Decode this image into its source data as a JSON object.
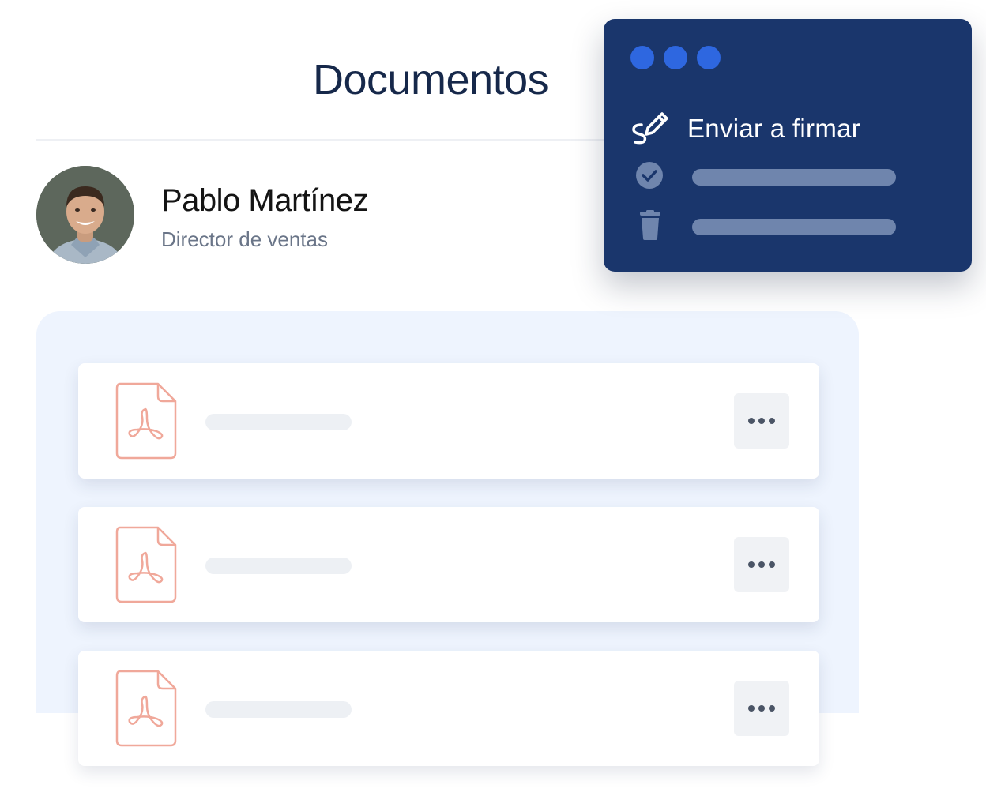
{
  "header": {
    "title": "Documentos"
  },
  "user": {
    "name": "Pablo Martínez",
    "role": "Director de ventas"
  },
  "documents": [
    {
      "icon": "pdf-file-icon",
      "name": ""
    },
    {
      "icon": "pdf-file-icon",
      "name": ""
    },
    {
      "icon": "pdf-file-icon",
      "name": ""
    }
  ],
  "context_menu": {
    "items": [
      {
        "icon": "sign-pen-icon",
        "label": "Enviar a firmar"
      },
      {
        "icon": "check-circle-icon",
        "label": ""
      },
      {
        "icon": "trash-icon",
        "label": ""
      }
    ]
  },
  "icons": {
    "more": "more-dots-icon"
  },
  "colors": {
    "title": "#16284a",
    "menu_background": "#1a366c",
    "menu_dots": "#2e67e0",
    "pdf_icon": "#f0a89a",
    "panel_background": "#eef4fe"
  }
}
